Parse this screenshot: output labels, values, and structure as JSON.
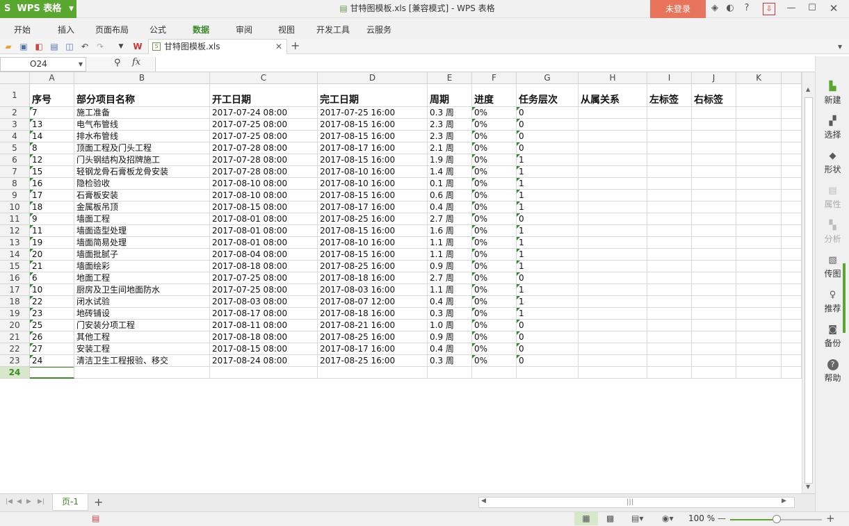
{
  "app": {
    "name": "WPS 表格",
    "title": "甘特图模板.xls [兼容模式] - WPS 表格",
    "login_label": "未登录",
    "accent_color": "#5aa730",
    "login_color": "#e7745b"
  },
  "menu": [
    "开始",
    "插入",
    "页面布局",
    "公式",
    "数据",
    "审阅",
    "视图",
    "开发工具",
    "云服务"
  ],
  "active_menu": "数据",
  "doc_tab": {
    "label": "甘特图模板.xls"
  },
  "formula_bar": {
    "cell_ref": "O24",
    "fx": "fx",
    "value": ""
  },
  "columns": [
    "A",
    "B",
    "C",
    "D",
    "E",
    "F",
    "G",
    "H",
    "I",
    "J",
    "K"
  ],
  "header_row": [
    "序号",
    "部分项目名称",
    "开工日期",
    "完工日期",
    "周期",
    "进度",
    "任务层次",
    "从属关系",
    "左标签",
    "右标签",
    ""
  ],
  "rows": [
    [
      "7",
      "施工准备",
      "2017-07-24 08:00",
      "2017-07-25 16:00",
      "0.3 周",
      "0%",
      "0"
    ],
    [
      "13",
      "电气布管线",
      "2017-07-25 08:00",
      "2017-08-15 16:00",
      "2.3 周",
      "0%",
      "0"
    ],
    [
      "14",
      "排水布管线",
      "2017-07-25 08:00",
      "2017-08-15 16:00",
      "2.3 周",
      "0%",
      "0"
    ],
    [
      "8",
      "顶面工程及门头工程",
      "2017-07-28 08:00",
      "2017-08-17 16:00",
      "2.1 周",
      "0%",
      "0"
    ],
    [
      "12",
      "门头钢结构及招牌施工",
      "2017-07-28 08:00",
      "2017-08-15 16:00",
      "1.9 周",
      "0%",
      "1"
    ],
    [
      "15",
      "轻钢龙骨石膏板龙骨安装",
      "2017-07-28 08:00",
      "2017-08-10 16:00",
      "1.4 周",
      "0%",
      "1"
    ],
    [
      "16",
      "隐检验收",
      "2017-08-10 08:00",
      "2017-08-10 16:00",
      "0.1 周",
      "0%",
      "1"
    ],
    [
      "17",
      "石膏板安装",
      "2017-08-10 08:00",
      "2017-08-15 16:00",
      "0.6 周",
      "0%",
      "1"
    ],
    [
      "18",
      "金属板吊顶",
      "2017-08-15 08:00",
      "2017-08-17 16:00",
      "0.4 周",
      "0%",
      "1"
    ],
    [
      "9",
      "墙面工程",
      "2017-08-01 08:00",
      "2017-08-25 16:00",
      "2.7 周",
      "0%",
      "0"
    ],
    [
      "11",
      "墙面造型处理",
      "2017-08-01 08:00",
      "2017-08-15 16:00",
      "1.6 周",
      "0%",
      "1"
    ],
    [
      "19",
      "墙面简易处理",
      "2017-08-01 08:00",
      "2017-08-10 16:00",
      "1.1 周",
      "0%",
      "1"
    ],
    [
      "20",
      "墙面批腻子",
      "2017-08-04 08:00",
      "2017-08-15 16:00",
      "1.1 周",
      "0%",
      "1"
    ],
    [
      "21",
      "墙面绘彩",
      "2017-08-18 08:00",
      "2017-08-25 16:00",
      "0.9 周",
      "0%",
      "1"
    ],
    [
      "6",
      "地面工程",
      "2017-07-25 08:00",
      "2017-08-18 16:00",
      "2.7 周",
      "0%",
      "0"
    ],
    [
      "10",
      "厨房及卫生间地面防水",
      "2017-07-25 08:00",
      "2017-08-03 16:00",
      "1.1 周",
      "0%",
      "1"
    ],
    [
      "22",
      "闭水试验",
      "2017-08-03 08:00",
      "2017-08-07 12:00",
      "0.4 周",
      "0%",
      "1"
    ],
    [
      "23",
      "地砖铺设",
      "2017-08-17 08:00",
      "2017-08-18 16:00",
      "0.3 周",
      "0%",
      "1"
    ],
    [
      "25",
      "门安装分项工程",
      "2017-08-11 08:00",
      "2017-08-21 16:00",
      "1.0 周",
      "0%",
      "0"
    ],
    [
      "26",
      "其他工程",
      "2017-08-18 08:00",
      "2017-08-25 16:00",
      "0.9 周",
      "0%",
      "0"
    ],
    [
      "27",
      "安装工程",
      "2017-08-15 08:00",
      "2017-08-17 16:00",
      "0.4 周",
      "0%",
      "0"
    ],
    [
      "24",
      "清洁卫生工程报验、移交",
      "2017-08-24 08:00",
      "2017-08-25 16:00",
      "0.3 周",
      "0%",
      "0"
    ]
  ],
  "row_numbers": [
    "1",
    "2",
    "3",
    "4",
    "5",
    "6",
    "7",
    "8",
    "9",
    "10",
    "11",
    "12",
    "13",
    "14",
    "15",
    "16",
    "17",
    "18",
    "19",
    "20",
    "21",
    "22",
    "23",
    "24"
  ],
  "selected_row": "24",
  "right_panel": [
    {
      "label": "新建",
      "icon": "new-icon",
      "enabled": true
    },
    {
      "label": "选择",
      "icon": "select-icon",
      "enabled": true
    },
    {
      "label": "形状",
      "icon": "shape-icon",
      "enabled": true
    },
    {
      "label": "属性",
      "icon": "property-icon",
      "enabled": false
    },
    {
      "label": "分析",
      "icon": "analysis-icon",
      "enabled": false
    },
    {
      "label": "传图",
      "icon": "upload-image-icon",
      "enabled": true
    },
    {
      "label": "推荐",
      "icon": "recommend-icon",
      "enabled": true
    },
    {
      "label": "备份",
      "icon": "backup-icon",
      "enabled": true
    },
    {
      "label": "帮助",
      "icon": "help-icon",
      "enabled": true
    }
  ],
  "sheet_tab": {
    "label": "页-1"
  },
  "status": {
    "zoom": "100 %",
    "zoom_fraction": 0.5
  }
}
